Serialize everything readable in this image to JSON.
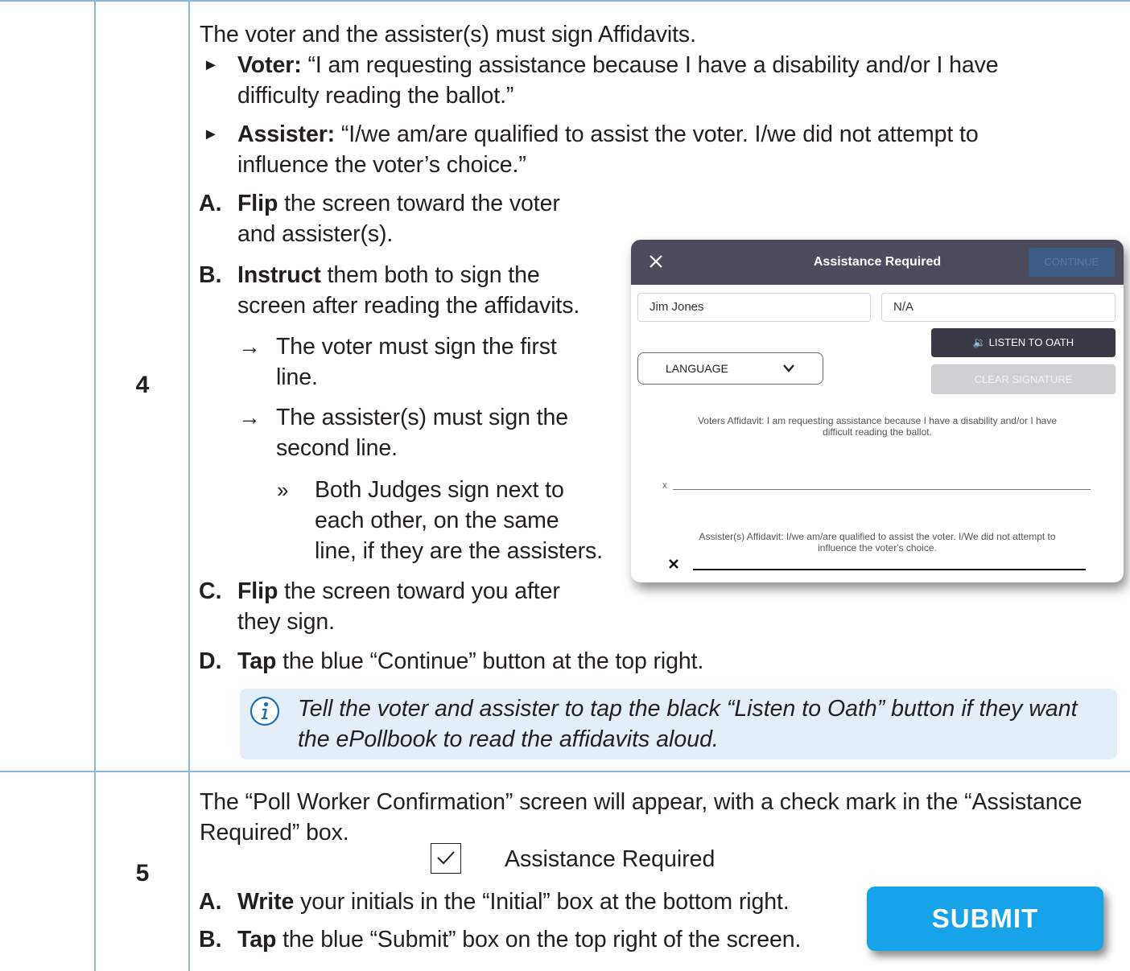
{
  "step4": {
    "number": "4",
    "intro": "The voter and the assister(s) must sign Affidavits.",
    "voter_label": "Voter:",
    "voter_line1": "“I am requesting assistance because I have a disability and/or I have",
    "voter_line2": "difficulty reading the ballot.”",
    "assister_label": "Assister:",
    "assister_line1": "“I/we am/are qualified to assist the voter.  I/we did not attempt to",
    "assister_line2": "influence the voter’s choice.”",
    "a_letter": "A.",
    "a_bold": "Flip",
    "a_line1": " the screen toward the voter",
    "a_line2": "and assister(s).",
    "b_letter": "B.",
    "b_bold": "Instruct",
    "b_line1": " them both to sign the",
    "b_line2": "screen after reading the affidavits.",
    "arrow1_line1": "The voter must sign the first",
    "arrow1_line2": "line.",
    "arrow2_line1": "The assister(s) must sign the",
    "arrow2_line2": "second line.",
    "sub_line1": "Both Judges sign next to",
    "sub_line2": "each other, on the same",
    "sub_line3": "line, if they are the assisters.",
    "c_letter": "C.",
    "c_bold": "Flip",
    "c_line1": " the screen toward you after",
    "c_line2": "they sign.",
    "d_letter": "D.",
    "d_bold": "Tap",
    "d_line1": " the blue “Continue” button at the top right.",
    "note_line1": "Tell the voter and assister to tap the black “Listen to Oath” button if they want",
    "note_line2": "the ePollbook to read the affidavits aloud."
  },
  "modal": {
    "title": "Assistance Required",
    "continue": "CONTINUE",
    "name_value": "Jim Jones",
    "second_value": "N/A",
    "listen": "🔉 LISTEN TO OATH",
    "clear": "CLEAR SIGNATURE",
    "language": "LANGUAGE",
    "voter_affidavit_line1": "Voters Affidavit: I am requesting assistance because I have a disability and/or I have",
    "voter_affidavit_line2": "difficult reading the ballot.",
    "sig1_x": "x",
    "assister_affidavit_line1": "Assister(s) Affidavit: I/we am/are qualified to assist the voter. I/We did not attempt to",
    "assister_affidavit_line2": "influence the voter's choice."
  },
  "step5": {
    "number": "5",
    "intro_line1": "The “Poll Worker Confirmation” screen will appear, with a check mark in the “Assistance",
    "intro_line2": "Required” box.",
    "checkbox_label": "Assistance Required",
    "a_letter": "A.",
    "a_bold": "Write",
    "a_line": " your initials in the “Initial” box at the bottom right.",
    "b_letter": "B.",
    "b_bold": "Tap",
    "b_line": " the blue “Submit” box on the top right of the screen.",
    "submit": "SUBMIT"
  },
  "colors": {
    "rule": "#8fb7da",
    "note_bg": "#e3eef8",
    "info_icon": "#1a6fb5",
    "modal_header": "#4c4c5c",
    "submit": "#16a3ea"
  }
}
